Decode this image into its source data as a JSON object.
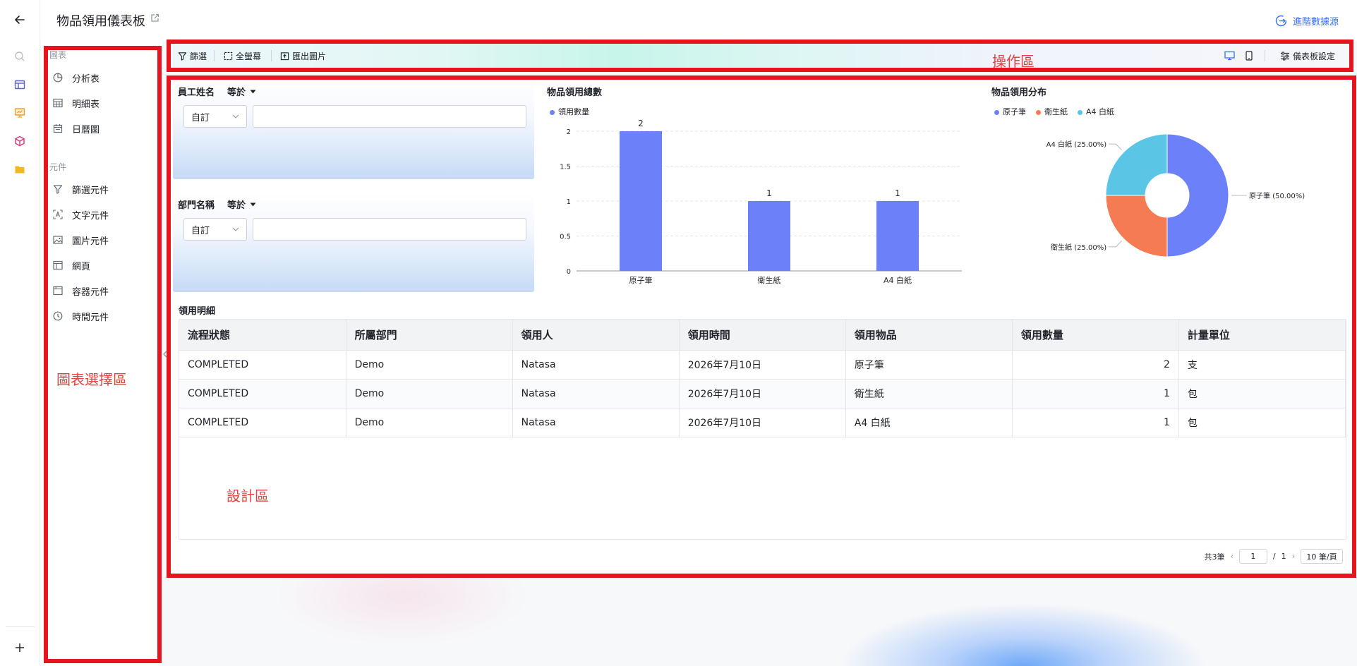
{
  "header": {
    "title": "物品領用儀表板",
    "advanced_data_source": "進階數據源"
  },
  "left_panel": {
    "charts_section": "圖表",
    "chart_items": [
      {
        "label": "分析表",
        "icon": "pie-chart-icon"
      },
      {
        "label": "明細表",
        "icon": "table-grid-icon"
      },
      {
        "label": "日曆圖",
        "icon": "calendar-icon"
      }
    ],
    "components_section": "元件",
    "component_items": [
      {
        "label": "篩選元件",
        "icon": "filter-icon"
      },
      {
        "label": "文字元件",
        "icon": "text-icon"
      },
      {
        "label": "圖片元件",
        "icon": "image-icon"
      },
      {
        "label": "網頁",
        "icon": "webpage-icon"
      },
      {
        "label": "容器元件",
        "icon": "container-icon"
      },
      {
        "label": "時間元件",
        "icon": "clock-icon"
      }
    ]
  },
  "toolbar": {
    "filter": "篩選",
    "fullscreen": "全螢幕",
    "export_image": "匯出圖片",
    "dashboard_settings": "儀表板設定"
  },
  "filters": [
    {
      "field": "員工姓名",
      "operator": "等於",
      "mode": "自訂",
      "value": ""
    },
    {
      "field": "部門名稱",
      "operator": "等於",
      "mode": "自訂",
      "value": ""
    }
  ],
  "bar_chart": {
    "title": "物品領用總數",
    "legend": "領用數量",
    "color": "#6c81f9"
  },
  "pie_chart": {
    "title": "物品領用分布",
    "colors": [
      "#6c81f9",
      "#f47b52",
      "#5bc5e6"
    ]
  },
  "chart_data": [
    {
      "type": "bar",
      "title": "物品領用總數",
      "categories": [
        "原子筆",
        "衛生紙",
        "A4 白紙"
      ],
      "series": [
        {
          "name": "領用數量",
          "values": [
            2,
            1,
            1
          ]
        }
      ],
      "ylim": [
        0,
        2
      ],
      "yticks": [
        "0",
        "0.5",
        "1",
        "1.5",
        "2"
      ],
      "data_labels": [
        "2",
        "1",
        "1"
      ],
      "legend": "top-left",
      "grid": true
    },
    {
      "type": "pie",
      "title": "物品領用分布",
      "categories": [
        "原子筆",
        "衛生紙",
        "A4 白紙"
      ],
      "values": [
        50,
        25,
        25
      ],
      "slice_labels": [
        "原子筆 (50.00%)",
        "衛生紙 (25.00%)",
        "A4 白紙 (25.00%)"
      ],
      "legend": "top-left",
      "donut": true
    }
  ],
  "table": {
    "title": "領用明細",
    "columns": [
      "流程狀態",
      "所屬部門",
      "領用人",
      "領用時間",
      "領用物品",
      "領用數量",
      "計量單位"
    ],
    "rows": [
      [
        "COMPLETED",
        "Demo",
        "Natasa",
        "2026年7月10日",
        "原子筆",
        "2",
        "支"
      ],
      [
        "COMPLETED",
        "Demo",
        "Natasa",
        "2026年7月10日",
        "衛生紙",
        "1",
        "包"
      ],
      [
        "COMPLETED",
        "Demo",
        "Natasa",
        "2026年7月10日",
        "A4 白紙",
        "1",
        "包"
      ]
    ]
  },
  "pager": {
    "total": "共3筆",
    "current": "1",
    "of": "/",
    "pages": "1",
    "page_size": "10 筆/頁"
  },
  "annotations": {
    "chart_select_area": "圖表選擇區",
    "operation_area": "操作區",
    "design_area": "設計區"
  }
}
